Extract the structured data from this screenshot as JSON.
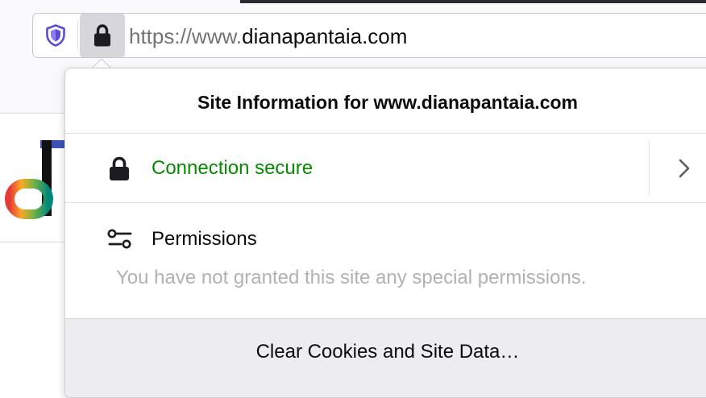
{
  "urlbar": {
    "url_prefix": "https://www.",
    "url_domain": "dianapantaia.com",
    "shield_icon": "tracking-protection-shield-icon",
    "lock_icon": "lock-icon"
  },
  "site_info_panel": {
    "title": "Site Information for www.dianapantaia.com",
    "connection": {
      "label": "Connection secure",
      "icon": "lock-icon",
      "color": "#058b00",
      "chevron_icon": "chevron-right-icon"
    },
    "permissions": {
      "label": "Permissions",
      "icon": "permissions-sliders-icon",
      "empty_text": "You have not granted this site any special permissions."
    },
    "footer_button": "Clear Cookies and Site Data…"
  },
  "colors": {
    "shield_accent": "#5b4bd8",
    "secure_green": "#058b00",
    "muted_text": "#b1b1b3"
  }
}
